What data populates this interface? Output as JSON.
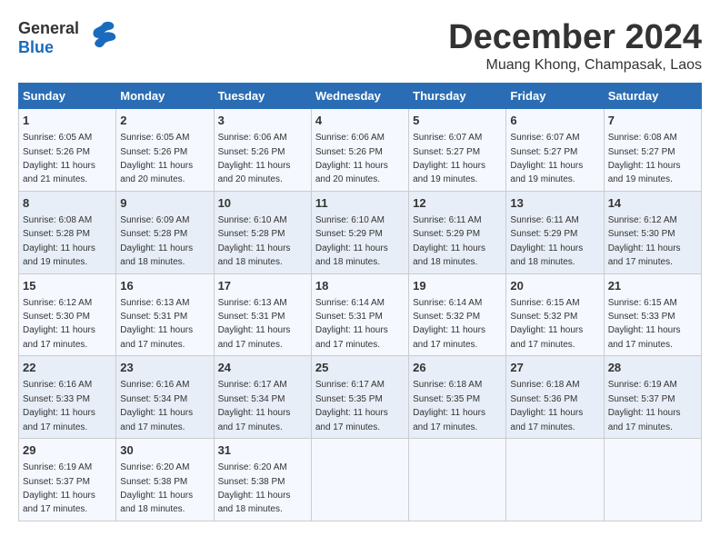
{
  "logo": {
    "general": "General",
    "blue": "Blue"
  },
  "title": "December 2024",
  "location": "Muang Khong, Champasak, Laos",
  "days_header": [
    "Sunday",
    "Monday",
    "Tuesday",
    "Wednesday",
    "Thursday",
    "Friday",
    "Saturday"
  ],
  "weeks": [
    [
      {
        "day": "1",
        "sunrise": "6:05 AM",
        "sunset": "5:26 PM",
        "daylight": "11 hours and 21 minutes."
      },
      {
        "day": "2",
        "sunrise": "6:05 AM",
        "sunset": "5:26 PM",
        "daylight": "11 hours and 20 minutes."
      },
      {
        "day": "3",
        "sunrise": "6:06 AM",
        "sunset": "5:26 PM",
        "daylight": "11 hours and 20 minutes."
      },
      {
        "day": "4",
        "sunrise": "6:06 AM",
        "sunset": "5:26 PM",
        "daylight": "11 hours and 20 minutes."
      },
      {
        "day": "5",
        "sunrise": "6:07 AM",
        "sunset": "5:27 PM",
        "daylight": "11 hours and 19 minutes."
      },
      {
        "day": "6",
        "sunrise": "6:07 AM",
        "sunset": "5:27 PM",
        "daylight": "11 hours and 19 minutes."
      },
      {
        "day": "7",
        "sunrise": "6:08 AM",
        "sunset": "5:27 PM",
        "daylight": "11 hours and 19 minutes."
      }
    ],
    [
      {
        "day": "8",
        "sunrise": "6:08 AM",
        "sunset": "5:28 PM",
        "daylight": "11 hours and 19 minutes."
      },
      {
        "day": "9",
        "sunrise": "6:09 AM",
        "sunset": "5:28 PM",
        "daylight": "11 hours and 18 minutes."
      },
      {
        "day": "10",
        "sunrise": "6:10 AM",
        "sunset": "5:28 PM",
        "daylight": "11 hours and 18 minutes."
      },
      {
        "day": "11",
        "sunrise": "6:10 AM",
        "sunset": "5:29 PM",
        "daylight": "11 hours and 18 minutes."
      },
      {
        "day": "12",
        "sunrise": "6:11 AM",
        "sunset": "5:29 PM",
        "daylight": "11 hours and 18 minutes."
      },
      {
        "day": "13",
        "sunrise": "6:11 AM",
        "sunset": "5:29 PM",
        "daylight": "11 hours and 18 minutes."
      },
      {
        "day": "14",
        "sunrise": "6:12 AM",
        "sunset": "5:30 PM",
        "daylight": "11 hours and 17 minutes."
      }
    ],
    [
      {
        "day": "15",
        "sunrise": "6:12 AM",
        "sunset": "5:30 PM",
        "daylight": "11 hours and 17 minutes."
      },
      {
        "day": "16",
        "sunrise": "6:13 AM",
        "sunset": "5:31 PM",
        "daylight": "11 hours and 17 minutes."
      },
      {
        "day": "17",
        "sunrise": "6:13 AM",
        "sunset": "5:31 PM",
        "daylight": "11 hours and 17 minutes."
      },
      {
        "day": "18",
        "sunrise": "6:14 AM",
        "sunset": "5:31 PM",
        "daylight": "11 hours and 17 minutes."
      },
      {
        "day": "19",
        "sunrise": "6:14 AM",
        "sunset": "5:32 PM",
        "daylight": "11 hours and 17 minutes."
      },
      {
        "day": "20",
        "sunrise": "6:15 AM",
        "sunset": "5:32 PM",
        "daylight": "11 hours and 17 minutes."
      },
      {
        "day": "21",
        "sunrise": "6:15 AM",
        "sunset": "5:33 PM",
        "daylight": "11 hours and 17 minutes."
      }
    ],
    [
      {
        "day": "22",
        "sunrise": "6:16 AM",
        "sunset": "5:33 PM",
        "daylight": "11 hours and 17 minutes."
      },
      {
        "day": "23",
        "sunrise": "6:16 AM",
        "sunset": "5:34 PM",
        "daylight": "11 hours and 17 minutes."
      },
      {
        "day": "24",
        "sunrise": "6:17 AM",
        "sunset": "5:34 PM",
        "daylight": "11 hours and 17 minutes."
      },
      {
        "day": "25",
        "sunrise": "6:17 AM",
        "sunset": "5:35 PM",
        "daylight": "11 hours and 17 minutes."
      },
      {
        "day": "26",
        "sunrise": "6:18 AM",
        "sunset": "5:35 PM",
        "daylight": "11 hours and 17 minutes."
      },
      {
        "day": "27",
        "sunrise": "6:18 AM",
        "sunset": "5:36 PM",
        "daylight": "11 hours and 17 minutes."
      },
      {
        "day": "28",
        "sunrise": "6:19 AM",
        "sunset": "5:37 PM",
        "daylight": "11 hours and 17 minutes."
      }
    ],
    [
      {
        "day": "29",
        "sunrise": "6:19 AM",
        "sunset": "5:37 PM",
        "daylight": "11 hours and 17 minutes."
      },
      {
        "day": "30",
        "sunrise": "6:20 AM",
        "sunset": "5:38 PM",
        "daylight": "11 hours and 18 minutes."
      },
      {
        "day": "31",
        "sunrise": "6:20 AM",
        "sunset": "5:38 PM",
        "daylight": "11 hours and 18 minutes."
      },
      null,
      null,
      null,
      null
    ]
  ]
}
